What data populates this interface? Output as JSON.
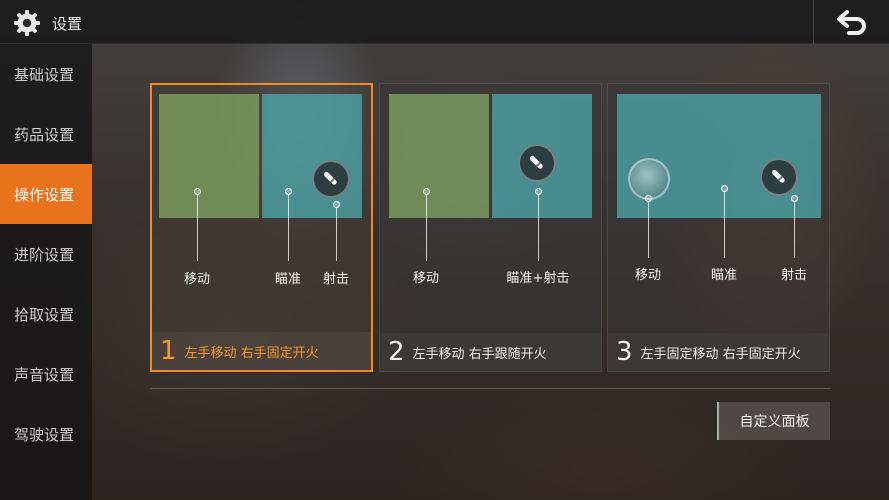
{
  "header": {
    "title": "设置",
    "settings_icon": "gear-icon",
    "back_icon": "back-arrow-icon"
  },
  "sidebar": {
    "items": [
      {
        "label": "基础设置"
      },
      {
        "label": "药品设置"
      },
      {
        "label": "操作设置",
        "active": true
      },
      {
        "label": "进阶设置"
      },
      {
        "label": "拾取设置"
      },
      {
        "label": "声音设置"
      },
      {
        "label": "驾驶设置"
      }
    ]
  },
  "presets": [
    {
      "number": "1",
      "description": "左手移动 右手固定开火",
      "selected": true,
      "labels": {
        "move": "移动",
        "aim": "瞄准",
        "fire": "射击"
      }
    },
    {
      "number": "2",
      "description": "左手移动 右手跟随开火",
      "selected": false,
      "labels": {
        "move": "移动",
        "aim_fire": "瞄准+射击"
      }
    },
    {
      "number": "3",
      "description": "左手固定移动 右手固定开火",
      "selected": false,
      "labels": {
        "move": "移动",
        "aim": "瞄准",
        "fire": "射击"
      }
    }
  ],
  "custom_panel_button": "自定义面板",
  "colors": {
    "accent": "#e8731c",
    "selected_text": "#f4992c",
    "left_zone": "#84aa62",
    "right_zone": "#4eaaaf"
  }
}
